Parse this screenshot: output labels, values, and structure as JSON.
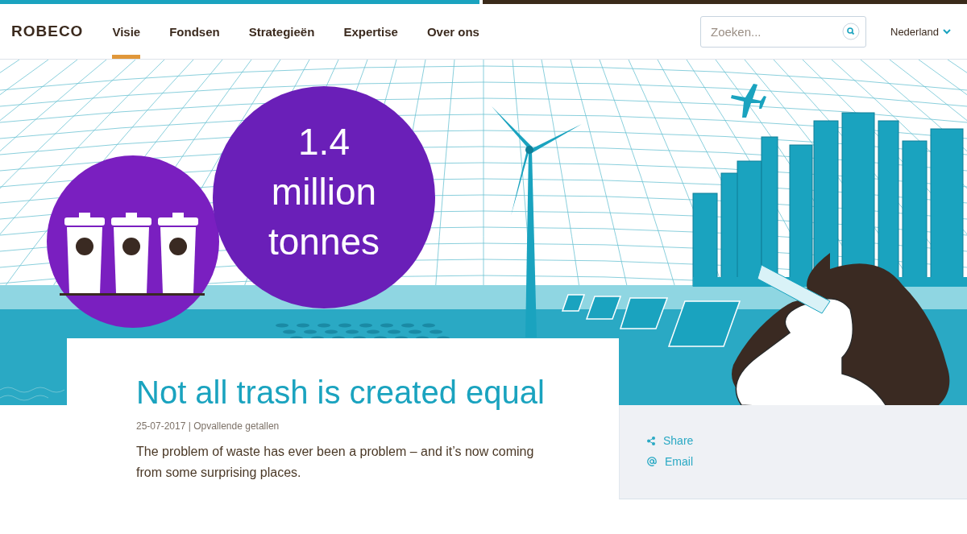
{
  "header": {
    "logo": "ROBECO",
    "nav": [
      {
        "label": "Visie",
        "selected": true
      },
      {
        "label": "Fondsen",
        "selected": false
      },
      {
        "label": "Strategieën",
        "selected": false
      },
      {
        "label": "Expertise",
        "selected": false
      },
      {
        "label": "Over ons",
        "selected": false
      }
    ],
    "search": {
      "placeholder": "Zoeken..."
    },
    "country": "Nederland"
  },
  "hero": {
    "stat": [
      "1.4",
      "million",
      "tonnes"
    ]
  },
  "article": {
    "title": "Not all trash is created equal",
    "meta": "25-07-2017 | Opvallende getallen",
    "intro": "The problem of waste has ever been a problem – and it’s now coming from some surprising places."
  },
  "share": [
    {
      "kind": "share",
      "label": "Share"
    },
    {
      "kind": "email",
      "label": "Email"
    }
  ]
}
